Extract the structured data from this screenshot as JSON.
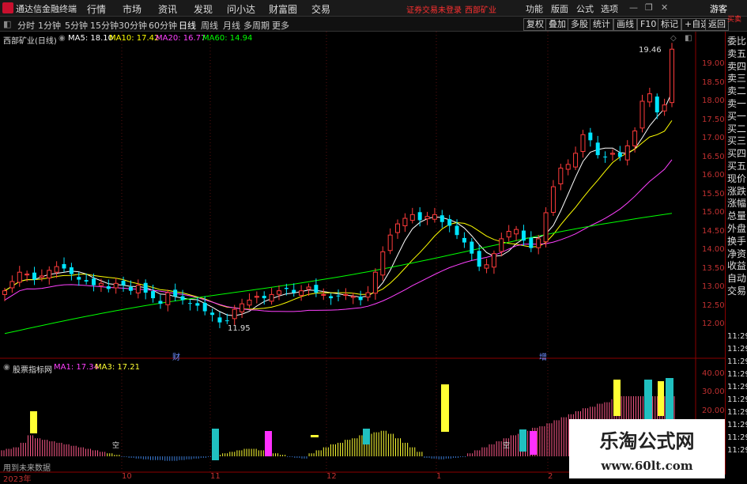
{
  "app": {
    "title": "通达信金融终端"
  },
  "menu": [
    "行情",
    "市场",
    "资讯",
    "发现",
    "问小达",
    "财富圈",
    "交易"
  ],
  "notice": {
    "login": "证券交易未登录",
    "stock": "西部矿业"
  },
  "right_menu": [
    "功能",
    "版面",
    "公式",
    "选项"
  ],
  "guest": "游客",
  "periods": [
    "分时",
    "1分钟",
    "5分钟",
    "15分钟",
    "30分钟",
    "60分钟",
    "日线",
    "周线",
    "月线",
    "多周期",
    "更多"
  ],
  "active_period": "日线",
  "tools": [
    "复权",
    "叠加",
    "多股",
    "统计",
    "画线",
    "F10",
    "标记",
    "+自选",
    "返回"
  ],
  "main_info": {
    "stock": "西部矿业(日线)",
    "ma5": "MA5: 18.10",
    "ma10": "MA10: 17.42",
    "ma20": "MA20: 16.77",
    "ma60": "MA60: 14.94"
  },
  "sub_info": {
    "name": "股票指标网",
    "ma1": "MA1: 17.34",
    "ma3": "MA3: 17.21"
  },
  "annotations": {
    "high": "19.46",
    "low": "11.95",
    "cai": "财",
    "zeng": "增",
    "future": "用到未来数据",
    "tag_in": "空"
  },
  "price_axis": [
    "19.00",
    "18.50",
    "18.00",
    "17.50",
    "17.00",
    "16.50",
    "16.00",
    "15.50",
    "15.00",
    "14.50",
    "14.00",
    "13.50",
    "13.00",
    "12.50",
    "12.00"
  ],
  "sub_axis": [
    "40.00",
    "30.00",
    "20.00"
  ],
  "x_axis": [
    {
      "label": "2023年"
    },
    {
      "label": "10"
    },
    {
      "label": "11"
    },
    {
      "label": "12"
    },
    {
      "label": "1"
    },
    {
      "label": "2"
    }
  ],
  "right_panel": [
    "委比",
    "卖五",
    "卖四",
    "卖三",
    "卖二",
    "卖一",
    "买一",
    "买二",
    "买三",
    "买四",
    "买五",
    "现价",
    "涨跌",
    "涨幅",
    "总量",
    "外盘",
    "换手",
    "净资",
    "收益",
    "自动",
    "交易"
  ],
  "right_times": [
    "11:29",
    "11:29",
    "11:29",
    "11:29",
    "11:29",
    "11:29",
    "11:29",
    "11:29",
    "11:29",
    "11:29"
  ],
  "right_top": "买卖",
  "watermark": {
    "line1": "乐淘公式网",
    "line2": "www.60lt.com"
  },
  "colors": {
    "up": "#ff3b3b",
    "down": "#00e5ff",
    "ma5": "#ffffff",
    "ma10": "#ffff00",
    "ma20": "#ff40ff",
    "ma60": "#00ff00",
    "bar_yellow": "#ffff33",
    "bar_pink": "#ff5a8a",
    "bar_cyan": "#20c0c0",
    "bar_magenta": "#ff30ff",
    "bar_blue": "#3a7bd5"
  },
  "chart_data": {
    "type": "candlestick",
    "closes": [
      12.9,
      13.15,
      13.4,
      13.35,
      13.2,
      13.3,
      13.45,
      13.55,
      13.5,
      13.35,
      13.2,
      13.15,
      13.05,
      13.1,
      12.95,
      13.1,
      13.05,
      12.9,
      13.05,
      12.85,
      12.7,
      12.55,
      12.85,
      12.75,
      12.65,
      12.55,
      12.5,
      12.35,
      12.25,
      12.05,
      12.1,
      12.4,
      12.55,
      12.65,
      12.75,
      12.7,
      12.8,
      12.9,
      12.95,
      12.85,
      12.9,
      13.0,
      12.85,
      12.8,
      12.7,
      12.75,
      12.8,
      12.75,
      12.65,
      12.85,
      13.4,
      13.95,
      14.4,
      14.7,
      14.85,
      14.95,
      14.8,
      14.9,
      14.95,
      14.75,
      14.65,
      14.4,
      14.2,
      13.9,
      13.55,
      13.6,
      13.9,
      14.3,
      14.5,
      14.55,
      14.25,
      14.05,
      14.3,
      15.0,
      15.7,
      16.2,
      16.3,
      16.6,
      17.1,
      16.95,
      16.55,
      16.5,
      16.6,
      16.5,
      16.8,
      17.2,
      18.0,
      18.2,
      17.7,
      17.9,
      19.4
    ],
    "sub_values": [
      4,
      5,
      6,
      9,
      14,
      12,
      11,
      10,
      9,
      8,
      7,
      6,
      5,
      4,
      3,
      2,
      1,
      -1,
      -2,
      -3,
      -4,
      -5,
      -5,
      -6,
      -6,
      -5,
      -4,
      -3,
      -2,
      -1,
      1,
      2,
      3,
      4,
      5,
      5,
      4,
      3,
      2,
      1,
      -1,
      -2,
      -3,
      2,
      4,
      6,
      8,
      9,
      11,
      12,
      14,
      15,
      16,
      17,
      15,
      12,
      9,
      6,
      3,
      -2,
      -3,
      -4,
      -3,
      -2,
      -1,
      2,
      4,
      6,
      8,
      10,
      12,
      14,
      15,
      17,
      19,
      20,
      22,
      24,
      26,
      28,
      30,
      32,
      33,
      35,
      36,
      38,
      40,
      41,
      42,
      43,
      44,
      45,
      46,
      47
    ]
  }
}
